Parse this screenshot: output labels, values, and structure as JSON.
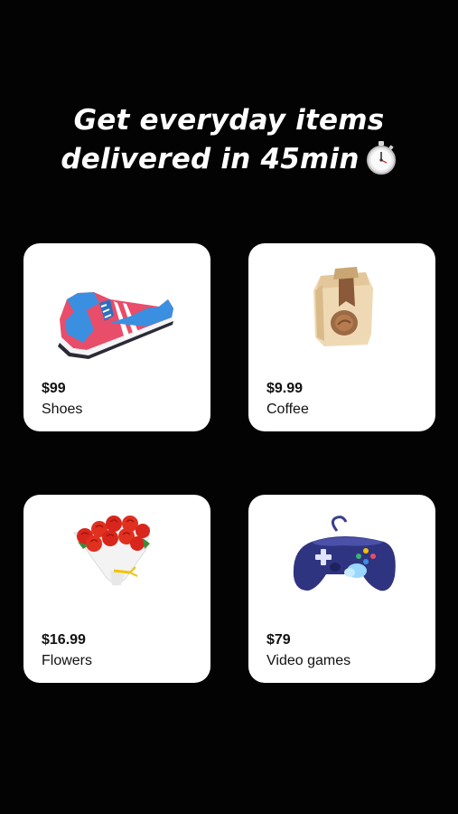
{
  "headline": {
    "line1": "Get everyday items",
    "line2": "delivered in 45min"
  },
  "headline_icon": "stopwatch-icon",
  "products": [
    {
      "price": "$99",
      "name": "Shoes",
      "icon": "sneaker-icon"
    },
    {
      "price": "$9.99",
      "name": "Coffee",
      "icon": "coffee-bag-icon"
    },
    {
      "price": "$16.99",
      "name": "Flowers",
      "icon": "rose-bouquet-icon"
    },
    {
      "price": "$79",
      "name": "Video games",
      "icon": "game-controller-icon"
    }
  ],
  "colors": {
    "background": "#030303",
    "card": "#ffffff",
    "text_light": "#ffffff",
    "text_dark": "#111111"
  }
}
